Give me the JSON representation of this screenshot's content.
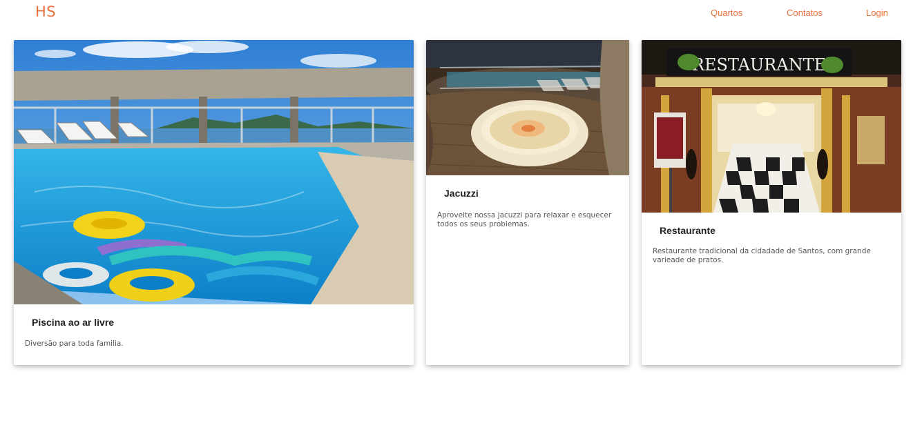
{
  "brand": {
    "logo_text": "HS"
  },
  "nav": {
    "items": [
      "Quartos",
      "Contatos",
      "Login"
    ]
  },
  "colors": {
    "accent": "#e8703a",
    "title": "#222222",
    "body": "#555555"
  },
  "cards": [
    {
      "image": "pool-photo",
      "title": "Piscina ao ar livre",
      "description": "Diversão para toda familia."
    },
    {
      "image": "jacuzzi-photo",
      "title": "Jacuzzi",
      "description": "Aproveite nossa jacuzzi para relaxar e esquecer todos os seus problemas."
    },
    {
      "image": "restaurant-photo",
      "title": "Restaurante",
      "description": "Restaurante tradicional da cidadade de Santos, com grande varieade de pratos.",
      "sign_text": "RESTAURANTE"
    }
  ]
}
